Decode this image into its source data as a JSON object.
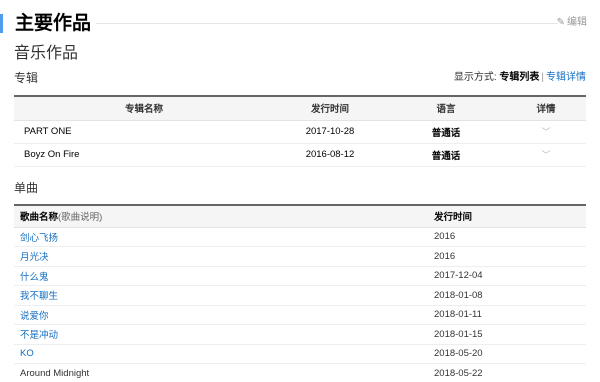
{
  "section": {
    "title": "主要作品",
    "edit_label": "编辑"
  },
  "music": {
    "title": "音乐作品"
  },
  "albums": {
    "label": "专辑",
    "display_mode_label": "显示方式:",
    "display_mode_list": "专辑列表",
    "display_mode_detail": "专辑详情",
    "columns": [
      "专辑名称",
      "发行时间",
      "语言",
      "详情"
    ],
    "rows": [
      {
        "name": "PART ONE",
        "date": "2017-10-28",
        "language": "普通话"
      },
      {
        "name": "Boyz On Fire",
        "date": "2016-08-12",
        "language": "普通话"
      }
    ]
  },
  "singles": {
    "label": "单曲",
    "col_name": "歌曲名称",
    "col_name_note": "(歌曲说明)",
    "col_date": "发行时间",
    "rows": [
      {
        "name": "剑心飞扬",
        "date": "2016",
        "link": true
      },
      {
        "name": "月光决",
        "date": "2016",
        "link": true
      },
      {
        "name": "什么鬼",
        "date": "2017-12-04",
        "link": true
      },
      {
        "name": "我不聊生",
        "date": "2018-01-08",
        "link": true
      },
      {
        "name": "说爱你",
        "date": "2018-01-11",
        "link": true
      },
      {
        "name": "不是冲动",
        "date": "2018-01-15",
        "link": true
      },
      {
        "name": "KO",
        "date": "2018-05-20",
        "link": true
      },
      {
        "name": "Around Midnight",
        "date": "2018-05-22",
        "link": false
      }
    ]
  },
  "colors": {
    "accent": "#4f9cee",
    "link": "#136ec2"
  },
  "icons": {
    "edit": "pencil-icon",
    "expand": "chevron-down-icon"
  }
}
